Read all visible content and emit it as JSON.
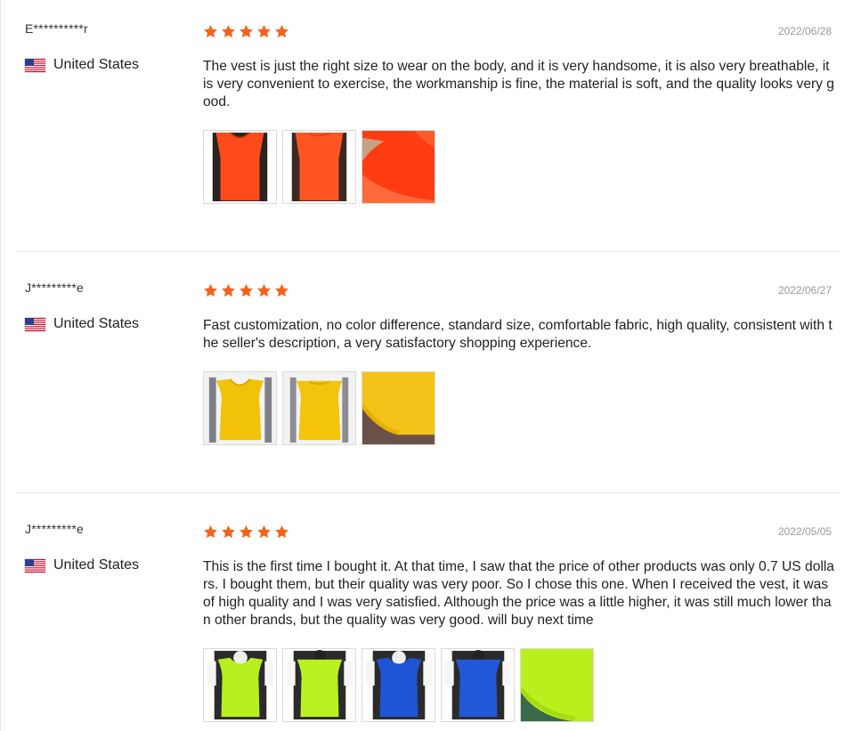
{
  "colors": {
    "star": "#f5621a",
    "text": "#222222",
    "date": "#999999",
    "divider": "#ebebeb"
  },
  "reviews": [
    {
      "reviewer": "E**********r",
      "country": "United States",
      "rating": 5,
      "date": "2022/06/28",
      "text": "The vest is just the right size to wear on the body, and it is very handsome, it is also very breathable, it is very convenient to exercise, the workmanship is fine, the material is soft, and the quality looks very good.",
      "photos": [
        "orange-vest-front-photo",
        "orange-vest-back-photo",
        "orange-fabric-closeup-photo"
      ]
    },
    {
      "reviewer": "J*********e",
      "country": "United States",
      "rating": 5,
      "date": "2022/06/27",
      "text": "Fast customization, no color difference, standard size, comfortable fabric, high quality, consistent with the seller's description, a very satisfactory shopping experience.",
      "photos": [
        "yellow-vest-front-photo",
        "yellow-vest-back-photo",
        "yellow-fabric-closeup-photo"
      ]
    },
    {
      "reviewer": "J*********e",
      "country": "United States",
      "rating": 5,
      "date": "2022/05/05",
      "text": "This is the first time I bought it. At that time, I saw that the price of other products was only 0.7 US dollars. I bought them, but their quality was very poor. So I chose this one. When I received the vest, it was of high quality and I was very satisfied. Although the price was a little higher, it was still much lower than other brands, but the quality was very good. will buy next time",
      "photos": [
        "green-vest-front-photo",
        "green-vest-back-photo",
        "blue-vest-front-photo",
        "blue-vest-back-photo",
        "green-fabric-closeup-photo"
      ]
    }
  ]
}
